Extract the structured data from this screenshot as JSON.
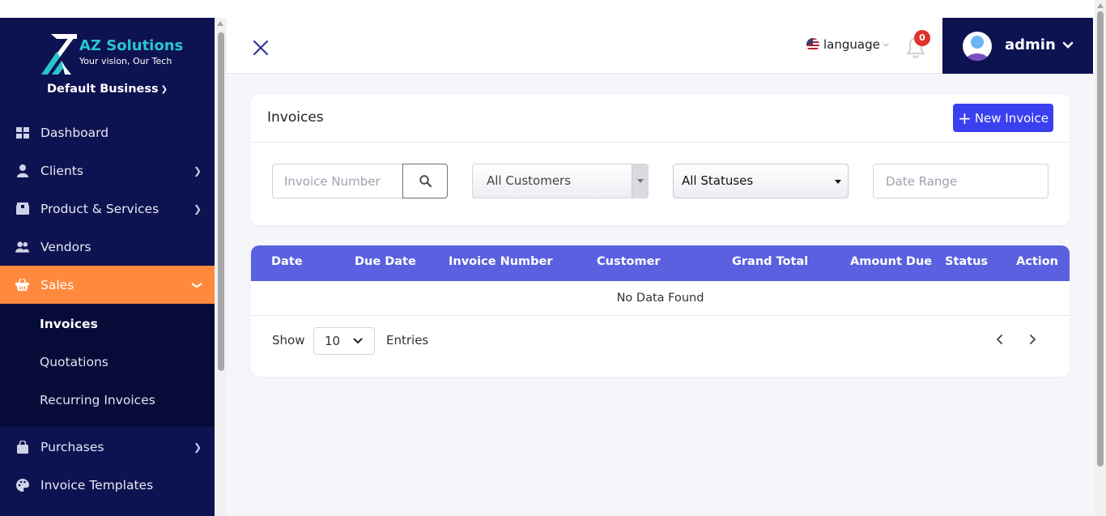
{
  "brand": {
    "title": "AZ Solutions",
    "tagline": "Your vision, Our Tech",
    "accent_color": "#28c5c9"
  },
  "business_selector": {
    "label": "Default Business"
  },
  "sidebar": {
    "items": [
      {
        "label": "Dashboard",
        "icon": "dashboard-icon",
        "has_arrow": false
      },
      {
        "label": "Clients",
        "icon": "user-icon",
        "has_arrow": true
      },
      {
        "label": "Product & Services",
        "icon": "box-icon",
        "has_arrow": true
      },
      {
        "label": "Vendors",
        "icon": "users-icon",
        "has_arrow": false
      },
      {
        "label": "Sales",
        "icon": "basket-icon",
        "has_arrow": true,
        "active": true
      },
      {
        "label": "Purchases",
        "icon": "bag-icon",
        "has_arrow": true
      },
      {
        "label": "Invoice Templates",
        "icon": "palette-icon",
        "has_arrow": false
      }
    ],
    "sales_submenu": [
      {
        "label": "Invoices",
        "current": true
      },
      {
        "label": "Quotations"
      },
      {
        "label": "Recurring Invoices"
      }
    ],
    "bg_color": "#0d1250",
    "active_color": "#ff8a3d"
  },
  "header": {
    "language_label": "language",
    "notification_count": "0",
    "user_name": "admin"
  },
  "filters": {
    "title": "Invoices",
    "new_button_label": "New Invoice",
    "invoice_number_placeholder": "Invoice Number",
    "customer_select_value": "All Customers",
    "status_select_value": "All Statuses",
    "date_range_placeholder": "Date Range"
  },
  "table": {
    "columns": [
      "Date",
      "Due Date",
      "Invoice Number",
      "Customer",
      "Grand Total",
      "Amount Due",
      "Status",
      "Action"
    ],
    "empty_message": "No Data Found",
    "header_color": "#5a60e0"
  },
  "pagination": {
    "show_label": "Show",
    "entries_value": "10",
    "entries_label": "Entries"
  },
  "colors": {
    "primary_button": "#3a3ff0",
    "badge": "#e0322a"
  }
}
